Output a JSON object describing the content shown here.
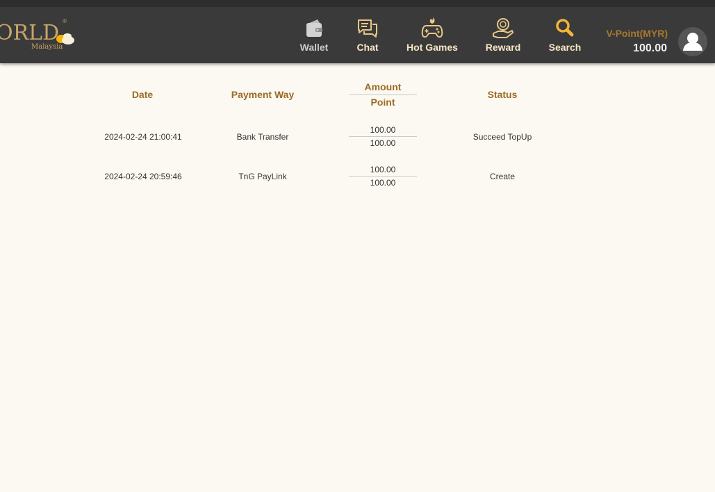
{
  "header": {
    "logo_text": "ORLD",
    "logo_sub": "Malaysia",
    "logo_mark": "®",
    "nav": [
      {
        "label": "Wallet",
        "icon": "wallet-icon"
      },
      {
        "label": "Chat",
        "icon": "chat-icon"
      },
      {
        "label": "Hot Games",
        "icon": "gamepad-icon"
      },
      {
        "label": "Reward",
        "icon": "reward-icon"
      },
      {
        "label": "Search",
        "icon": "search-icon"
      }
    ],
    "vpoint_label": "V-Point(MYR)",
    "vpoint_value": "100.00",
    "avatar_icon": "user-avatar-icon"
  },
  "table": {
    "headers": {
      "date": "Date",
      "payment_way": "Payment Way",
      "amount": "Amount",
      "point": "Point",
      "status": "Status"
    },
    "rows": [
      {
        "date": "2024-02-24 21:00:41",
        "payment_way": "Bank Transfer",
        "amount": "100.00",
        "point": "100.00",
        "status": "Succeed TopUp"
      },
      {
        "date": "2024-02-24 20:59:46",
        "payment_way": "TnG PayLink",
        "amount": "100.00",
        "point": "100.00",
        "status": "Create"
      }
    ]
  },
  "colors": {
    "header_bg": "#3a3a3a",
    "page_bg": "#fcf9f2",
    "gold": "#9a6b24",
    "nav_text": "#f6e6c4"
  }
}
